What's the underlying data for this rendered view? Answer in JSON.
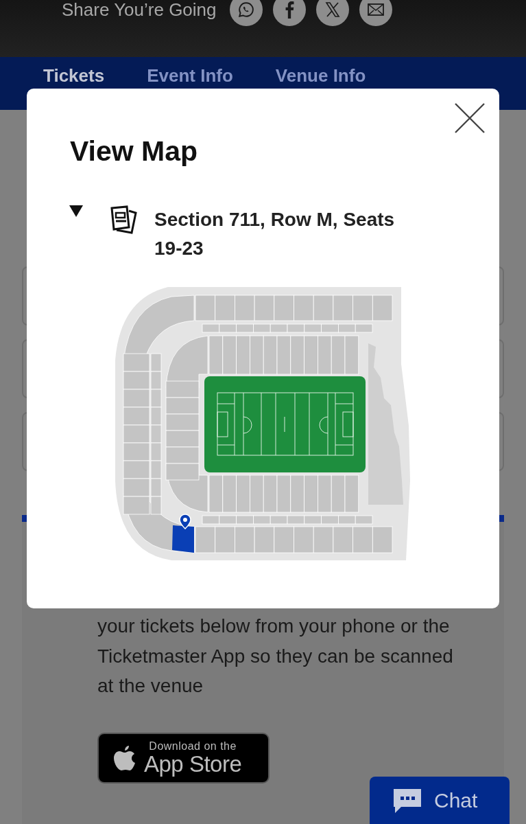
{
  "header": {
    "share_label": "Share You’re Going",
    "share_buttons": [
      {
        "kind": "whatsapp"
      },
      {
        "kind": "facebook"
      },
      {
        "kind": "x"
      },
      {
        "kind": "email"
      }
    ]
  },
  "tabs": [
    {
      "label": "Tickets",
      "selected": true
    },
    {
      "label": "Event Info",
      "selected": false
    },
    {
      "label": "Venue Info",
      "selected": false
    }
  ],
  "modal": {
    "title": "View Map",
    "section": {
      "label": "Section 711, Row M, Seats 19-23",
      "expanded": true
    }
  },
  "info": {
    "text": "your tickets below from your phone or the Ticketmaster App so they can be scanned at the venue",
    "store_badge": {
      "small": "Download on the",
      "large": "App Store"
    }
  },
  "chat": {
    "label": "Chat"
  }
}
